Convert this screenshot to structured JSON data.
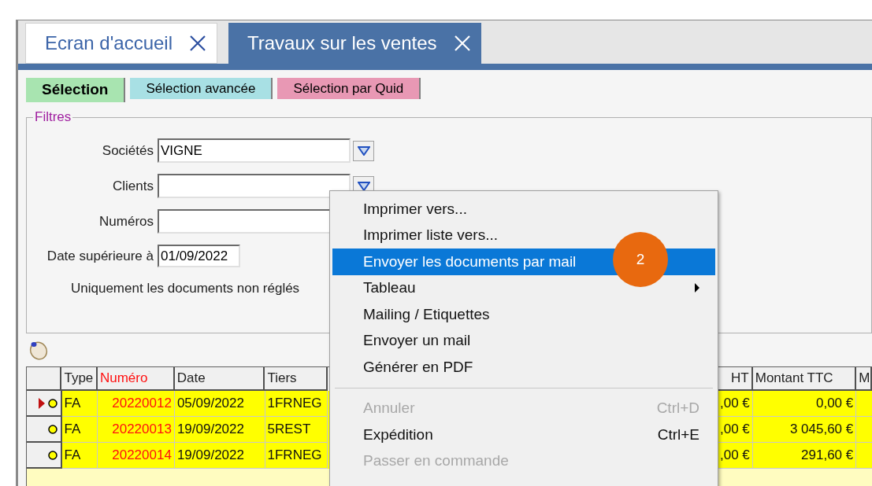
{
  "tabs": [
    {
      "label": "Ecran d'accueil",
      "selected": false
    },
    {
      "label": "Travaux sur les ventes",
      "selected": true
    }
  ],
  "subtabs": [
    {
      "label": "Sélection",
      "selected": true,
      "color": "#a8e4b0"
    },
    {
      "label": "Sélection avancée",
      "selected": false,
      "color": "#a8e0e4"
    },
    {
      "label": "Sélection par Quid",
      "selected": false,
      "color": "#e898b4"
    }
  ],
  "filters": {
    "title": "Filtres",
    "fields": [
      {
        "label": "Sociétés",
        "value": "VIGNE",
        "kind": "combo"
      },
      {
        "label": "Clients",
        "kind": "combo"
      },
      {
        "label": "Numéros",
        "kind": "text"
      },
      {
        "label": "Date supérieure à",
        "value": "01/09/2022",
        "kind": "date"
      }
    ],
    "option": {
      "label": "Uniquement les documents non réglés"
    }
  },
  "table": {
    "columns": [
      "Type",
      "Numéro",
      "Date",
      "Tiers",
      "HT",
      "Montant TTC",
      "M"
    ],
    "rows": [
      {
        "selected": true,
        "cells": [
          "FA",
          "20220012",
          "05/09/2022",
          "1FRNEG",
          ",00 €",
          "0,00 €"
        ]
      },
      {
        "selected": false,
        "cells": [
          "FA",
          "20220013",
          "19/09/2022",
          "5REST",
          ",00 €",
          "3 045,60 €"
        ]
      },
      {
        "selected": false,
        "cells": [
          "FA",
          "20220014",
          "19/09/2022",
          "1FRNEG",
          ",00 €",
          "291,60 €"
        ]
      }
    ]
  },
  "context_menu": {
    "items": [
      {
        "kind": "item",
        "label": "Imprimer vers...",
        "selected": false,
        "disabled": false,
        "submenu": false
      },
      {
        "kind": "item",
        "label": "Imprimer liste vers...",
        "selected": false,
        "disabled": false,
        "submenu": false
      },
      {
        "kind": "item",
        "label": "Envoyer les documents par mail",
        "selected": true,
        "disabled": false,
        "submenu": false
      },
      {
        "kind": "item",
        "label": "Tableau",
        "selected": false,
        "disabled": false,
        "submenu": true
      },
      {
        "kind": "item",
        "label": "Mailing / Etiquettes",
        "selected": false,
        "disabled": false,
        "submenu": false
      },
      {
        "kind": "item",
        "label": "Envoyer un mail",
        "selected": false,
        "disabled": false,
        "submenu": false
      },
      {
        "kind": "item",
        "label": "Générer en PDF",
        "selected": false,
        "disabled": false,
        "submenu": false
      },
      {
        "kind": "separator"
      },
      {
        "kind": "item",
        "label": "Annuler",
        "shortcut": "Ctrl+D",
        "selected": false,
        "disabled": true,
        "submenu": false
      },
      {
        "kind": "item",
        "label": "Expédition",
        "shortcut": "Ctrl+E",
        "selected": false,
        "disabled": false,
        "submenu": false
      },
      {
        "kind": "item",
        "label": "Passer en commande",
        "selected": false,
        "disabled": true,
        "submenu": false
      }
    ],
    "callout": {
      "label": "2"
    }
  }
}
